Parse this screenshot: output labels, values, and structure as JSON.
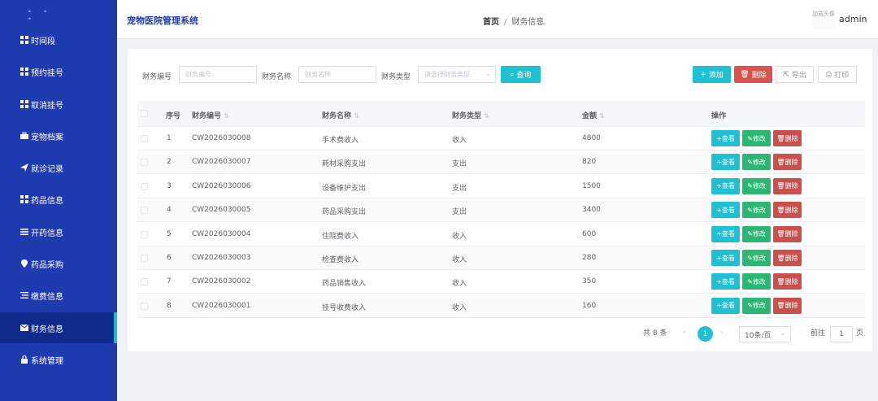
{
  "app": {
    "title": "宠物医院管理系统",
    "user": "admin",
    "avatar_text": "加载头像"
  },
  "breadcrumb": {
    "home": "首页",
    "separator": "/",
    "current": "财务信息"
  },
  "sidebar": {
    "items": [
      {
        "label": "时间段",
        "icon": "grid-icon"
      },
      {
        "label": "预约挂号",
        "icon": "grid-icon"
      },
      {
        "label": "取消挂号",
        "icon": "grid-icon"
      },
      {
        "label": "宠物档案",
        "icon": "briefcase-icon"
      },
      {
        "label": "就诊记录",
        "icon": "send-icon"
      },
      {
        "label": "药品信息",
        "icon": "grid-icon"
      },
      {
        "label": "开药信息",
        "icon": "list-icon"
      },
      {
        "label": "药品采购",
        "icon": "location-icon"
      },
      {
        "label": "缴费信息",
        "icon": "menu-icon"
      },
      {
        "label": "财务信息",
        "icon": "mail-icon",
        "active": true
      },
      {
        "label": "系统管理",
        "icon": "lock-icon"
      }
    ]
  },
  "filters": {
    "code_label": "财务编号",
    "code_placeholder": "财务编号",
    "name_label": "财务名称",
    "name_placeholder": "财务名称",
    "type_label": "财务类型",
    "type_placeholder": "请选择财务类型",
    "search_label": "查询"
  },
  "toolbar": {
    "add_label": "添加",
    "delete_label": "删除",
    "export_label": "导出",
    "print_label": "打印"
  },
  "table": {
    "headers": {
      "index": "序号",
      "code": "财务编号",
      "name": "财务名称",
      "type": "财务类型",
      "amount": "金额",
      "actions": "操作"
    },
    "action_labels": {
      "view": "查看",
      "edit": "修改",
      "delete": "删除"
    },
    "rows": [
      {
        "index": "1",
        "code": "CW2026030008",
        "name": "手术费收入",
        "type": "收入",
        "amount": "4800"
      },
      {
        "index": "2",
        "code": "CW2026030007",
        "name": "耗材采购支出",
        "type": "支出",
        "amount": "820"
      },
      {
        "index": "3",
        "code": "CW2026030006",
        "name": "设备维护支出",
        "type": "支出",
        "amount": "1500"
      },
      {
        "index": "4",
        "code": "CW2026030005",
        "name": "药品采购支出",
        "type": "支出",
        "amount": "3400"
      },
      {
        "index": "5",
        "code": "CW2026030004",
        "name": "住院费收入",
        "type": "收入",
        "amount": "600"
      },
      {
        "index": "6",
        "code": "CW2026030003",
        "name": "检查费收入",
        "type": "收入",
        "amount": "280"
      },
      {
        "index": "7",
        "code": "CW2026030002",
        "name": "药品销售收入",
        "type": "收入",
        "amount": "350"
      },
      {
        "index": "8",
        "code": "CW2026030001",
        "name": "挂号收费收入",
        "type": "收入",
        "amount": "160"
      }
    ]
  },
  "pagination": {
    "total_text": "共 8 条",
    "current_page": "1",
    "page_size": "10条/页",
    "goto_prefix": "前往",
    "goto_value": "1",
    "goto_suffix": "页"
  },
  "colors": {
    "sidebar_bg": "#1e3bb0",
    "sidebar_active": "#0f2a8a",
    "accent": "#1fc0d1",
    "danger": "#d9534f",
    "success": "#2bb673"
  }
}
